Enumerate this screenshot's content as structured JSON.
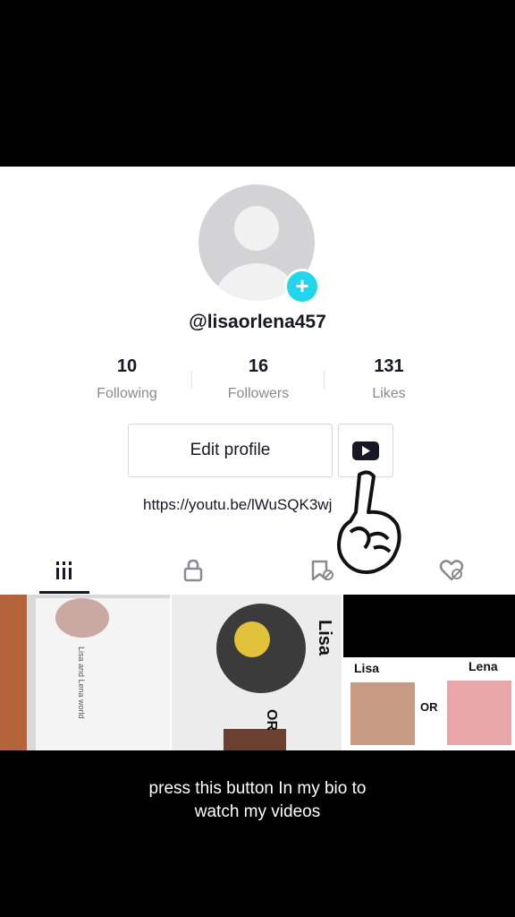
{
  "profile": {
    "username": "@lisaorlena457",
    "stats": [
      {
        "value": "10",
        "label": "Following"
      },
      {
        "value": "16",
        "label": "Followers"
      },
      {
        "value": "131",
        "label": "Likes"
      }
    ],
    "edit_label": "Edit profile",
    "bio_link": "https://youtu.be/lWuSQK3wj"
  },
  "tabs": [
    {
      "icon": "grid-icon"
    },
    {
      "icon": "lock-icon"
    },
    {
      "icon": "bookmark-icon"
    },
    {
      "icon": "liked-heart-icon"
    }
  ],
  "thumbs": {
    "t1": {
      "label": "Lisa and Lena world"
    },
    "t2": {
      "side_label": "Lisa",
      "or": "OR"
    },
    "t3": {
      "left": "Lisa",
      "or": "OR",
      "right": "Lena"
    }
  },
  "caption": {
    "line1": "press this button In my bio to",
    "line2": "watch my videos"
  },
  "colors": {
    "accent": "#20d5ec",
    "text": "#161823",
    "muted": "#8a8b91"
  }
}
